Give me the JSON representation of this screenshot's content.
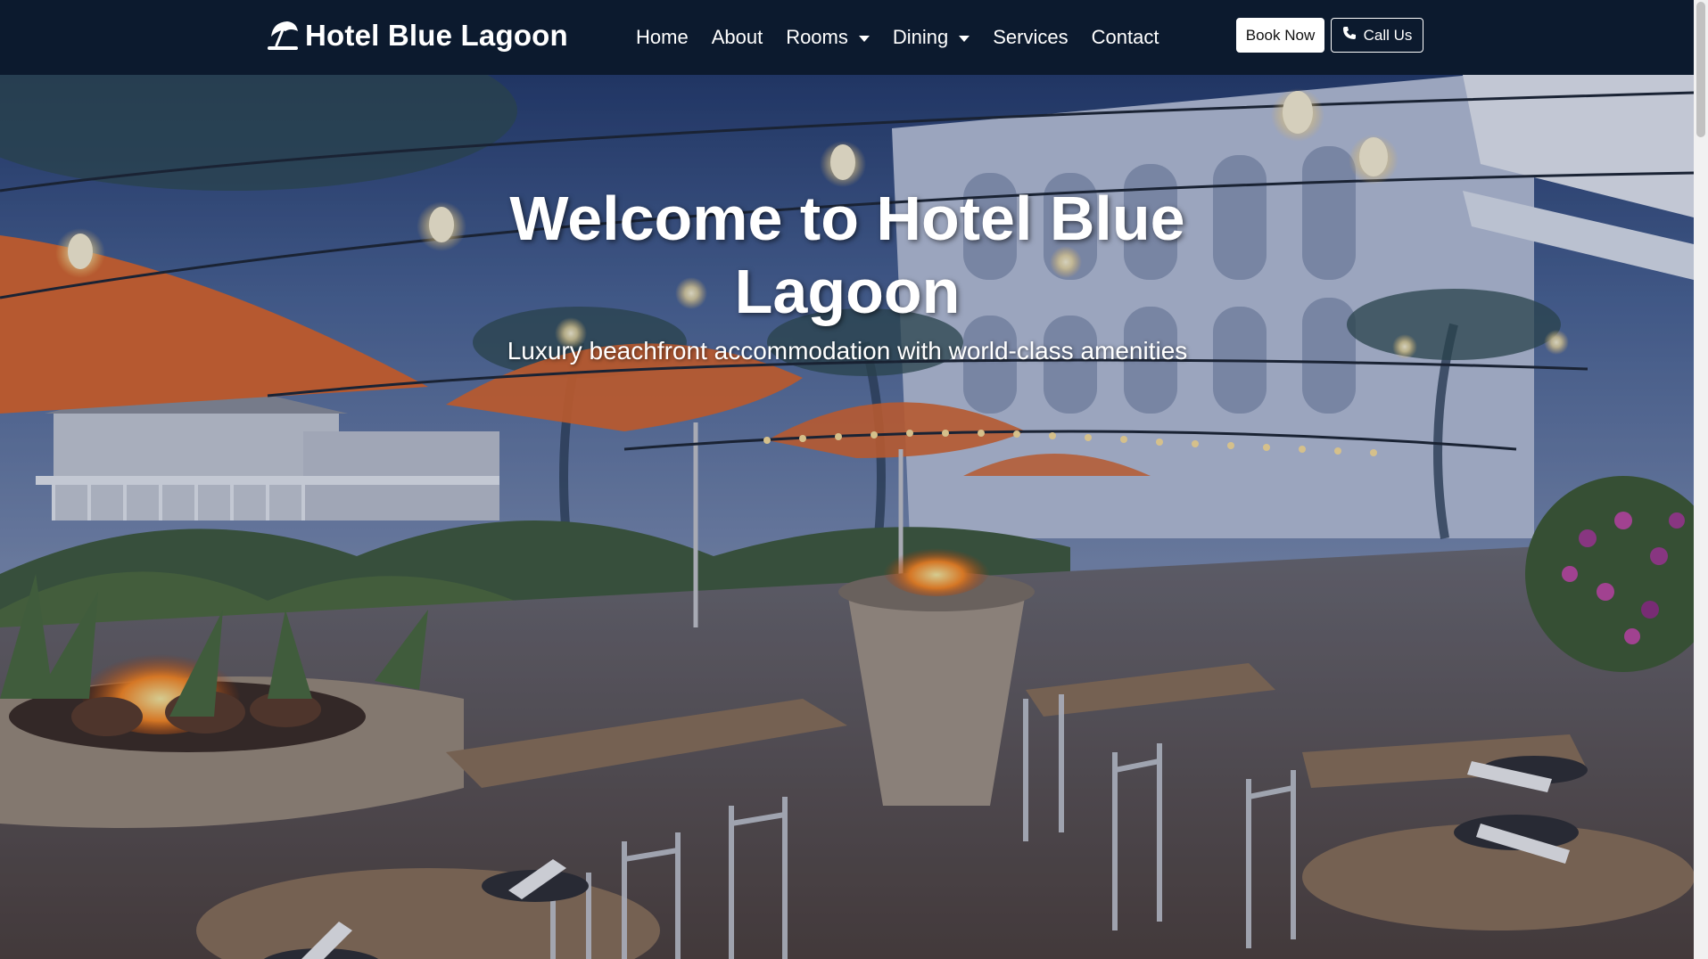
{
  "navbar": {
    "brand": "Hotel Blue Lagoon",
    "brand_icon": "umbrella-beach-icon",
    "links": [
      {
        "label": "Home",
        "dropdown": false
      },
      {
        "label": "About",
        "dropdown": false
      },
      {
        "label": "Rooms",
        "dropdown": true
      },
      {
        "label": "Dining",
        "dropdown": true
      },
      {
        "label": "Services",
        "dropdown": false
      },
      {
        "label": "Contact",
        "dropdown": false
      }
    ],
    "book_label": "Book Now",
    "call_label": "Call Us",
    "call_icon": "phone-icon"
  },
  "hero": {
    "title": "Welcome to Hotel Blue Lagoon",
    "subtitle": "Luxury beachfront accommodation with world-class amenities",
    "image_description_icon": "restaurant-patio-image"
  },
  "colors": {
    "navbar_bg": "#0c1a2e",
    "text_light": "#ffffff",
    "umbrella": "#d9662b"
  }
}
